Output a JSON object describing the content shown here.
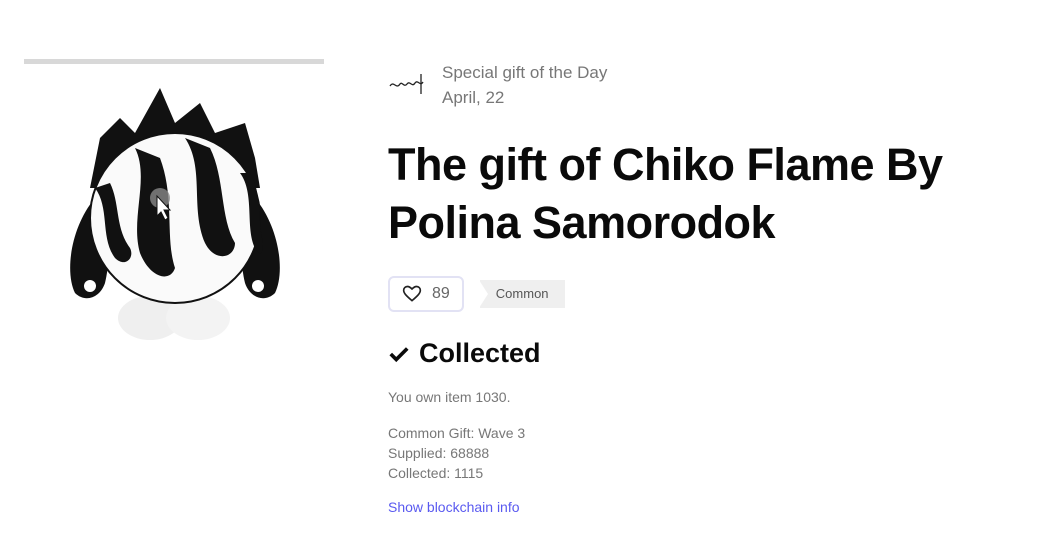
{
  "gift": {
    "label": "Special gift of the Day",
    "date": "April, 22",
    "title": "The gift of Chiko Flame By Polina Samorodok",
    "likes": "89",
    "rarity": "Common",
    "status": "Collected",
    "own_text": "You own item 1030.",
    "wave": "Common Gift: Wave 3",
    "supplied": "Supplied: 68888",
    "collected_count": "Collected: 1115",
    "blockchain_link": "Show blockchain info"
  },
  "colors": {
    "link": "#5a5af0",
    "muted": "#777777",
    "title": "#0a0a0a"
  },
  "icons": {
    "artist_logo": "artist-signature-icon",
    "like": "heart-icon",
    "status": "checkmark-icon",
    "cursor": "hand-pointer-icon"
  }
}
